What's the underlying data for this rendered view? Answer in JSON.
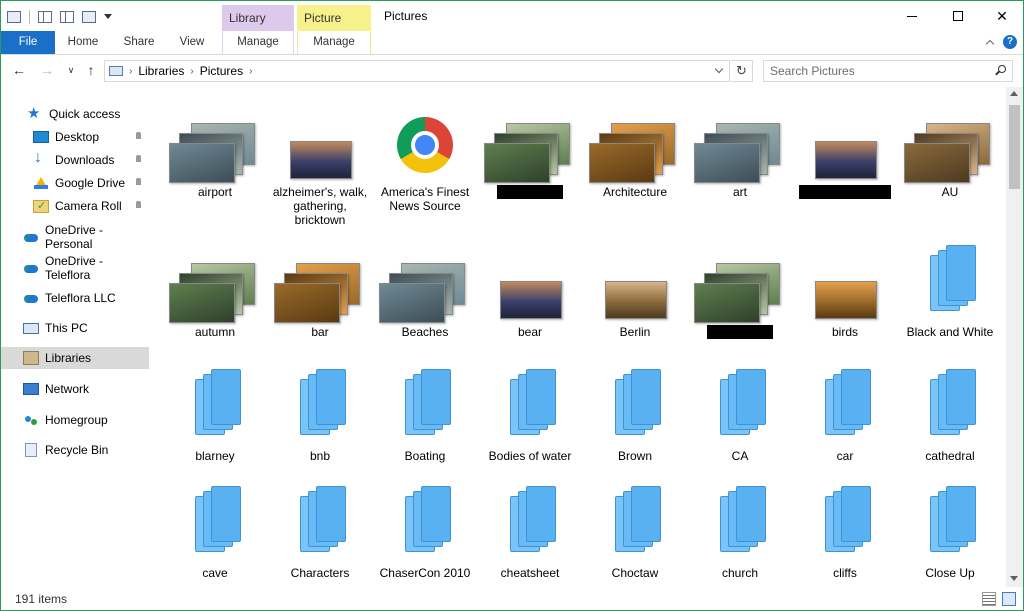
{
  "window": {
    "title": "Pictures",
    "context_tabs": [
      {
        "label": "Library Tools",
        "color": "#ddc9ec"
      },
      {
        "label": "Picture Tools",
        "color": "#f6f18a"
      }
    ]
  },
  "ribbon": {
    "tabs": [
      "File",
      "Home",
      "Share",
      "View",
      "Manage",
      "Manage"
    ],
    "file_color": "#1a6fc9"
  },
  "address": {
    "path": [
      "Libraries",
      "Pictures"
    ],
    "search_placeholder": "Search Pictures"
  },
  "nav": {
    "items": [
      {
        "label": "Quick access",
        "icon": "star-icon"
      },
      {
        "label": "Desktop",
        "icon": "desktop-icon",
        "pinned": true
      },
      {
        "label": "Downloads",
        "icon": "downloads-icon",
        "pinned": true
      },
      {
        "label": "Google Drive",
        "icon": "google-drive-icon",
        "pinned": true
      },
      {
        "label": "Camera Roll",
        "icon": "camera-roll-icon",
        "pinned": true
      },
      {
        "label": "OneDrive - Personal",
        "icon": "onedrive-icon"
      },
      {
        "label": "OneDrive - Teleflora",
        "icon": "onedrive-icon"
      },
      {
        "label": "Teleflora LLC",
        "icon": "building-icon"
      },
      {
        "label": "This PC",
        "icon": "pc-icon"
      },
      {
        "label": "Libraries",
        "icon": "libraries-icon",
        "selected": true
      },
      {
        "label": "Network",
        "icon": "network-icon"
      },
      {
        "label": "Homegroup",
        "icon": "homegroup-icon"
      },
      {
        "label": "Recycle Bin",
        "icon": "recycle-bin-icon"
      }
    ]
  },
  "items": [
    {
      "label": "airport",
      "kind": "photos"
    },
    {
      "label": "alzheimer's, walk, gathering, bricktown",
      "kind": "photo-single"
    },
    {
      "label": "America's Finest News Source",
      "kind": "chrome"
    },
    {
      "label": "",
      "kind": "photos",
      "redacted": true
    },
    {
      "label": "Architecture",
      "kind": "photos"
    },
    {
      "label": "art",
      "kind": "photos"
    },
    {
      "label": "",
      "kind": "photo-single",
      "redacted": true
    },
    {
      "label": "AU",
      "kind": "photos"
    },
    {
      "label": "autumn",
      "kind": "photos"
    },
    {
      "label": "bar",
      "kind": "photos"
    },
    {
      "label": "Beaches",
      "kind": "photos"
    },
    {
      "label": "bear",
      "kind": "photo-single"
    },
    {
      "label": "Berlin",
      "kind": "photo-single"
    },
    {
      "label": "",
      "kind": "photos",
      "redacted": true
    },
    {
      "label": "birds",
      "kind": "photo-single"
    },
    {
      "label": "Black and White",
      "kind": "folder"
    },
    {
      "label": "blarney",
      "kind": "folder"
    },
    {
      "label": "bnb",
      "kind": "folder"
    },
    {
      "label": "Boating",
      "kind": "folder"
    },
    {
      "label": "Bodies of water",
      "kind": "folder"
    },
    {
      "label": "Brown",
      "kind": "folder"
    },
    {
      "label": "CA",
      "kind": "folder"
    },
    {
      "label": "car",
      "kind": "folder"
    },
    {
      "label": "cathedral",
      "kind": "folder"
    },
    {
      "label": "cave",
      "kind": "folder"
    },
    {
      "label": "Characters",
      "kind": "folder"
    },
    {
      "label": "ChaserCon 2010",
      "kind": "folder"
    },
    {
      "label": "cheatsheet",
      "kind": "folder"
    },
    {
      "label": "Choctaw",
      "kind": "folder"
    },
    {
      "label": "church",
      "kind": "folder"
    },
    {
      "label": "cliffs",
      "kind": "folder"
    },
    {
      "label": "Close Up",
      "kind": "folder"
    }
  ],
  "status": {
    "count": "191 items"
  }
}
